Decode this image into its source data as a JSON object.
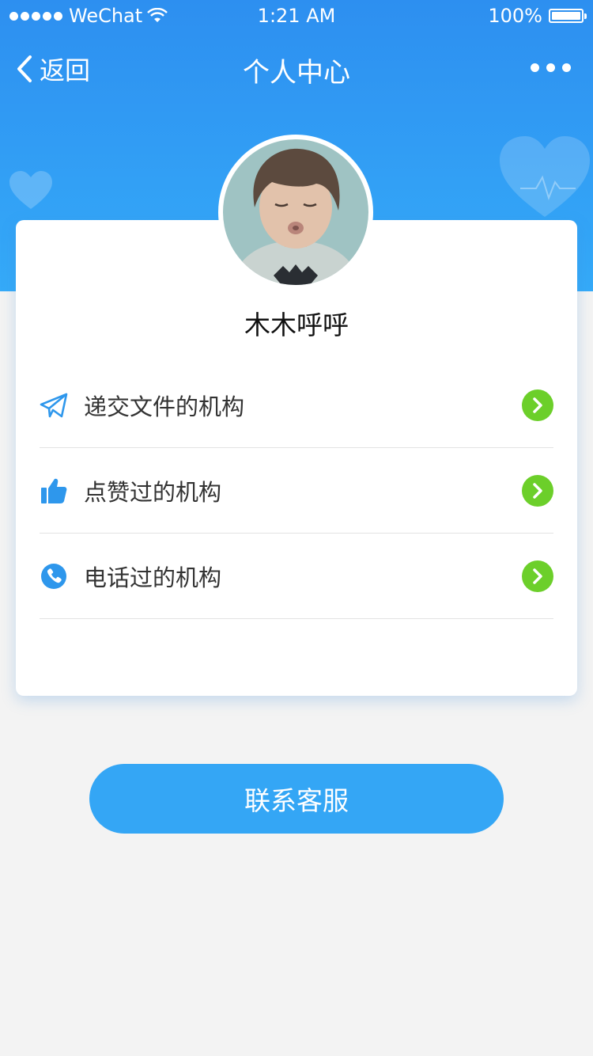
{
  "status_bar": {
    "carrier": "WeChat",
    "time": "1:21 AM",
    "battery": "100%",
    "battery_level": 1.0
  },
  "nav": {
    "back_label": "返回",
    "title": "个人中心"
  },
  "profile": {
    "username": "木木呼呼"
  },
  "menu": [
    {
      "label": "递交文件的机构",
      "icon": "paper-plane-icon"
    },
    {
      "label": "点赞过的机构",
      "icon": "thumbs-up-icon"
    },
    {
      "label": "电话过的机构",
      "icon": "phone-icon"
    }
  ],
  "contact_button": {
    "label": "联系客服"
  },
  "colors": {
    "header_top": "#2d8ff0",
    "header_bottom": "#35aaf8",
    "accent_blue": "#34a6f5",
    "arrow_green": "#6ccf2a",
    "background": "#f3f3f3"
  }
}
